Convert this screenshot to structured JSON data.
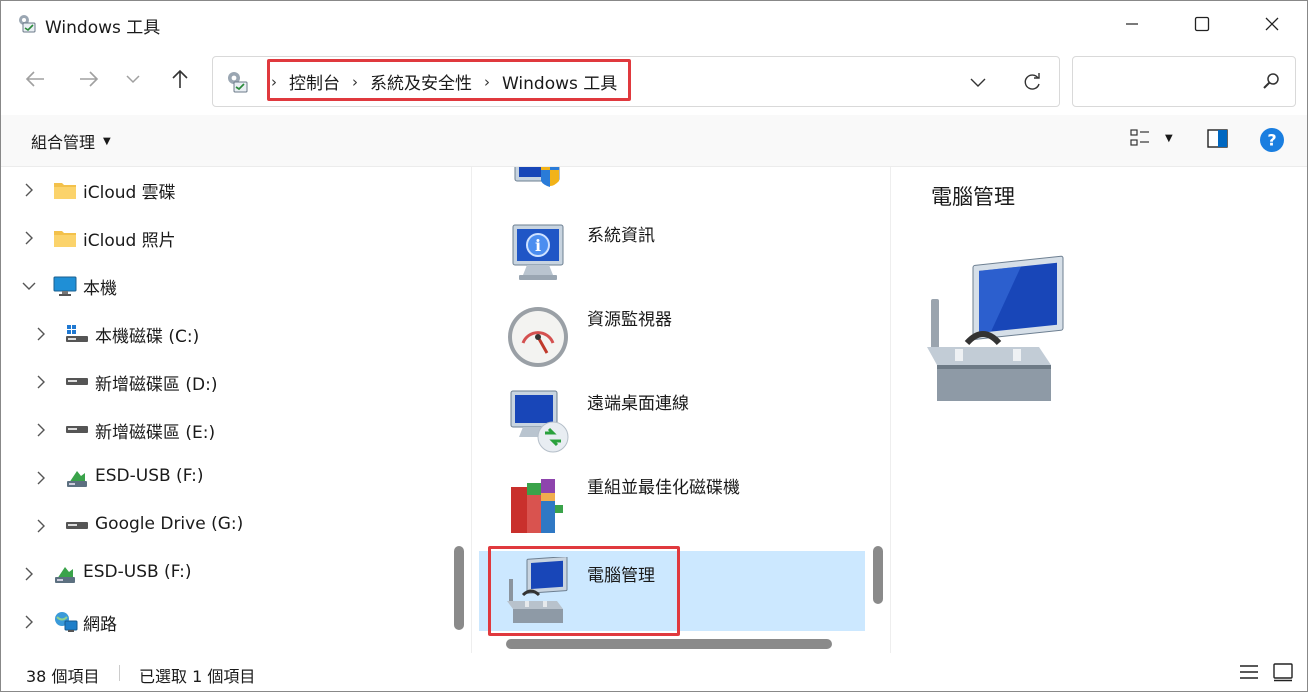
{
  "window": {
    "title": "Windows 工具",
    "minimize_icon": "minimize-icon",
    "maximize_icon": "maximize-icon",
    "close_icon": "close-icon"
  },
  "nav": {
    "back_icon": "arrow-left-icon",
    "forward_icon": "arrow-right-icon",
    "recent_icon": "chevron-down-icon",
    "up_icon": "arrow-up-icon"
  },
  "address": {
    "crumbs": [
      "控制台",
      "系統及安全性",
      "Windows 工具"
    ],
    "separator": "›"
  },
  "search": {
    "placeholder": ""
  },
  "commandbar": {
    "organize_label": "組合管理"
  },
  "tree": {
    "items": [
      {
        "label": "iCloud 雲碟",
        "icon": "folder-icon"
      },
      {
        "label": "iCloud 照片",
        "icon": "folder-icon"
      },
      {
        "label": "本機",
        "icon": "computer-icon"
      },
      {
        "label": "本機磁碟 (C:)",
        "icon": "windows-drive-icon"
      },
      {
        "label": "新增磁碟區 (D:)",
        "icon": "drive-icon"
      },
      {
        "label": "新增磁碟區 (E:)",
        "icon": "drive-icon"
      },
      {
        "label": "ESD-USB (F:)",
        "icon": "usb-drive-icon"
      },
      {
        "label": "Google Drive (G:)",
        "icon": "drive-icon"
      },
      {
        "label": "ESD-USB (F:)",
        "icon": "usb-drive-icon"
      },
      {
        "label": "網路",
        "icon": "network-icon"
      }
    ]
  },
  "files": {
    "items": [
      {
        "label": "",
        "icon": "security-monitor-icon"
      },
      {
        "label": "系統資訊",
        "icon": "system-info-icon"
      },
      {
        "label": "資源監視器",
        "icon": "resource-monitor-icon"
      },
      {
        "label": "遠端桌面連線",
        "icon": "remote-desktop-icon"
      },
      {
        "label": "重組並最佳化磁碟機",
        "icon": "defrag-icon"
      },
      {
        "label": "電腦管理",
        "icon": "computer-management-icon"
      }
    ]
  },
  "preview": {
    "title": "電腦管理",
    "icon": "computer-management-icon"
  },
  "status": {
    "count": "38 個項目",
    "selected": "已選取 1 個項目"
  },
  "colors": {
    "highlight": "#e0393e",
    "selection": "#cce8ff",
    "accent": "#0078d4"
  }
}
